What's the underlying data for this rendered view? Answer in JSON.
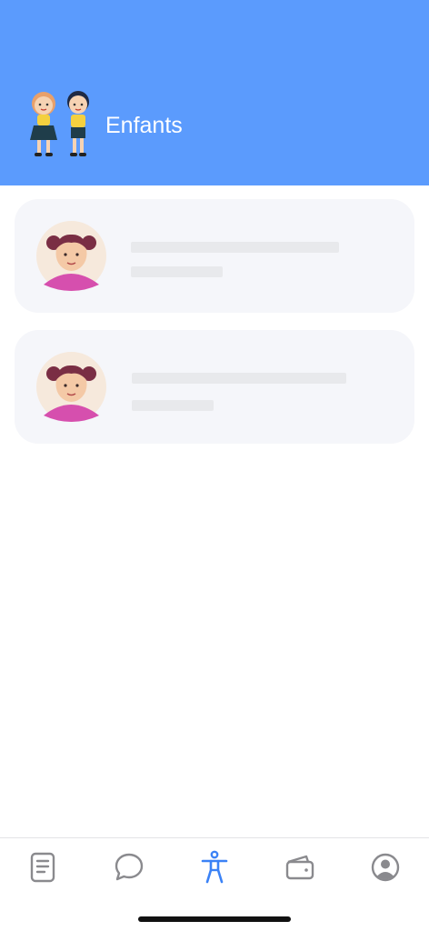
{
  "header": {
    "title": "Enfants",
    "background": "#5b9bfd",
    "illustration": "children-illustration"
  },
  "children": [
    {
      "avatar": "girl-avatar-icon",
      "name": "",
      "detail": ""
    },
    {
      "avatar": "girl-avatar-icon",
      "name": "",
      "detail": ""
    }
  ],
  "tabbar": {
    "active": "children",
    "accent": "#3b82f6",
    "inactive": "#8a8a8e",
    "tabs": [
      {
        "icon": "document-icon",
        "id": "documents"
      },
      {
        "icon": "chat-bubble-icon",
        "id": "messages"
      },
      {
        "icon": "person-accessibility-icon",
        "id": "children"
      },
      {
        "icon": "wallet-icon",
        "id": "wallet"
      },
      {
        "icon": "account-circle-icon",
        "id": "profile"
      }
    ]
  }
}
